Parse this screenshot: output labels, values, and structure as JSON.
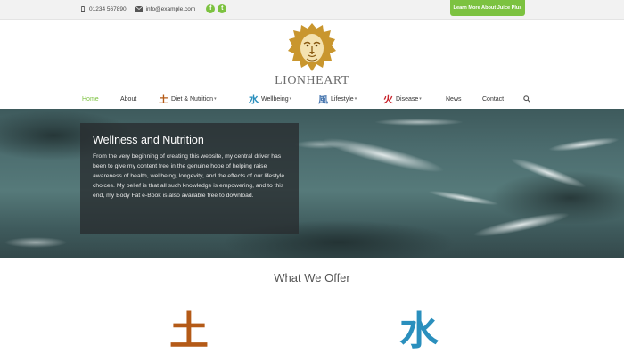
{
  "topbar": {
    "phone": "01234 567890",
    "email": "info@example.com",
    "cta_label": "Learn More About Juice Plus",
    "social": [
      {
        "icon": "facebook-icon",
        "glyph": "f"
      },
      {
        "icon": "twitter-icon",
        "glyph": "t"
      }
    ]
  },
  "logo": {
    "wordmark": "LIONHEART",
    "icon": "lion-head-icon"
  },
  "nav": {
    "items": [
      {
        "label": "Home",
        "active": true
      },
      {
        "label": "About"
      },
      {
        "label": "Diet & Nutrition",
        "glyph": "土",
        "dropdown": true
      },
      {
        "label": "Wellbeing",
        "glyph": "水",
        "dropdown": true
      },
      {
        "label": "Lifestyle",
        "glyph": "風",
        "dropdown": true
      },
      {
        "label": "Disease",
        "glyph": "火",
        "dropdown": true
      },
      {
        "label": "News"
      },
      {
        "label": "Contact"
      }
    ],
    "search_icon": "search-icon"
  },
  "hero": {
    "title": "Wellness and Nutrition",
    "body": "From the very beginning of creating this website, my central driver has been to give my content free in the genuine hope of helping raise awareness of health, wellbeing, longevity, and the effects of our lifestyle choices. My belief is that all such knowledge is empowering, and to this end, my Body Fat e-Book is also available free to download."
  },
  "offer": {
    "title": "What We Offer",
    "glyphs": [
      "土",
      "水"
    ]
  },
  "colors": {
    "accent": "#7cc240",
    "earth": "#b45a17",
    "water": "#2a8fbd",
    "wind": "#4a78b0",
    "fire": "#c8232c",
    "logo_gold": "#c9962e"
  }
}
